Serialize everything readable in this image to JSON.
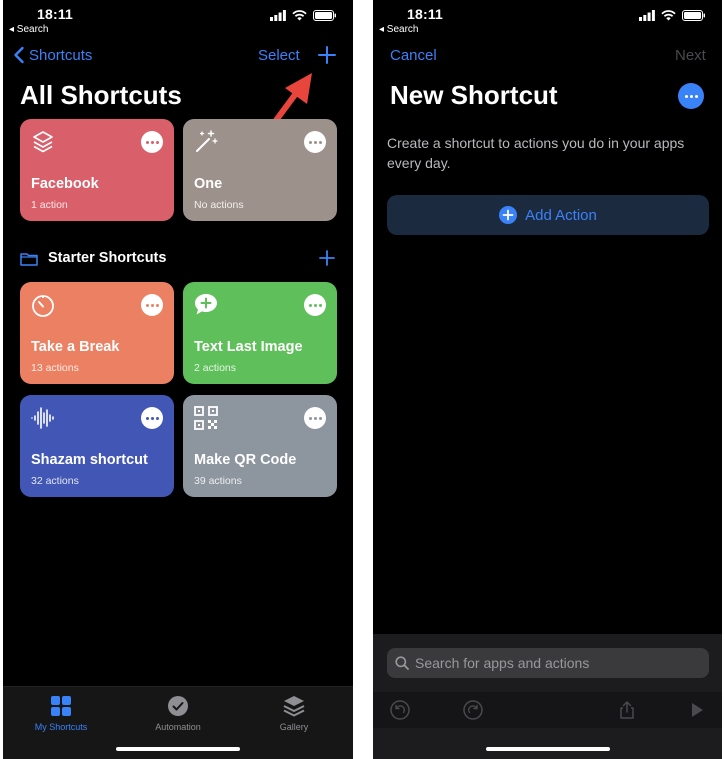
{
  "left_screen": {
    "status": {
      "time": "18:11",
      "back_app": "◂ Search"
    },
    "nav": {
      "back_label": "Shortcuts",
      "select_label": "Select"
    },
    "title": "All Shortcuts",
    "cards": [
      {
        "name": "Facebook",
        "sub": "1 action",
        "color": "#d9606a",
        "icon": "layers-icon"
      },
      {
        "name": "One",
        "sub": "No actions",
        "color": "#9d918b",
        "icon": "magic-wand-icon"
      }
    ],
    "starter_section": {
      "label": "Starter Shortcuts"
    },
    "starter_cards": [
      {
        "name": "Take a Break",
        "sub": "13 actions",
        "color": "#ec8063",
        "icon": "timer-icon"
      },
      {
        "name": "Text Last Image",
        "sub": "2 actions",
        "color": "#5fbf5a",
        "icon": "message-plus-icon"
      },
      {
        "name": "Shazam shortcut",
        "sub": "32 actions",
        "color": "#4257b5",
        "icon": "waveform-icon"
      },
      {
        "name": "Make QR Code",
        "sub": "39 actions",
        "color": "#8d959f",
        "icon": "qr-code-icon"
      }
    ],
    "tabs": [
      {
        "label": "My Shortcuts",
        "active": true
      },
      {
        "label": "Automation",
        "active": false
      },
      {
        "label": "Gallery",
        "active": false
      }
    ]
  },
  "right_screen": {
    "status": {
      "time": "18:11",
      "back_app": "◂ Search"
    },
    "nav": {
      "cancel_label": "Cancel",
      "next_label": "Next"
    },
    "title": "New Shortcut",
    "description": "Create a shortcut to actions you do in your apps every day.",
    "add_action_label": "Add Action",
    "search_placeholder": "Search for apps and actions"
  },
  "colors": {
    "accent": "#3a82f7",
    "background": "#000000",
    "arrow": "#e8453c"
  }
}
